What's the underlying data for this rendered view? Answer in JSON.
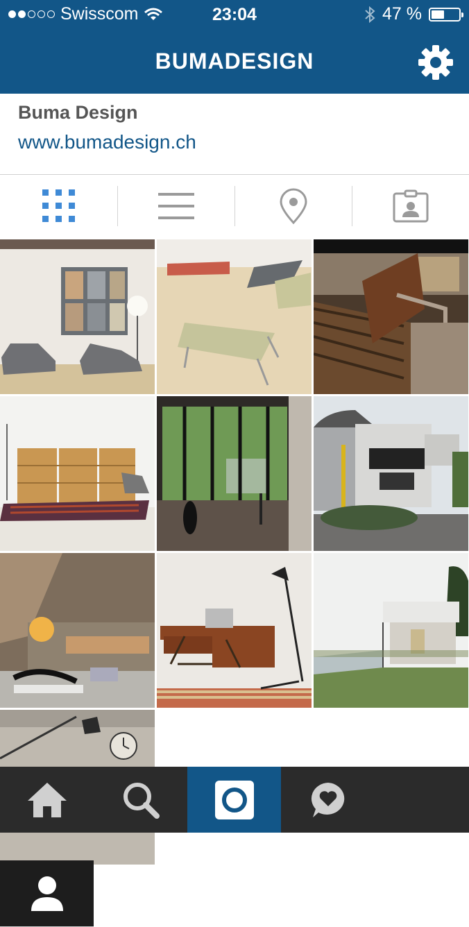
{
  "status": {
    "carrier": "Swisscom",
    "time": "23:04",
    "battery": "47 %",
    "battery_level": 0.47
  },
  "header": {
    "title": "BUMADESIGN"
  },
  "profile": {
    "name": "Buma Design",
    "website": "www.bumadesign.ch"
  },
  "tabs": [
    "grid-view",
    "list-view",
    "location",
    "tagged-photos"
  ],
  "photos": [
    "interior with two grey sofas",
    "tables on chipboard floor",
    "wooden bench close-up",
    "shelves with rug",
    "window view with figure",
    "modernist house",
    "loft interior with lounge chair",
    "wooden desk with lamp",
    "white house by water",
    "lamp and clock"
  ],
  "nav": [
    "home",
    "search",
    "camera",
    "activity",
    "profile"
  ]
}
